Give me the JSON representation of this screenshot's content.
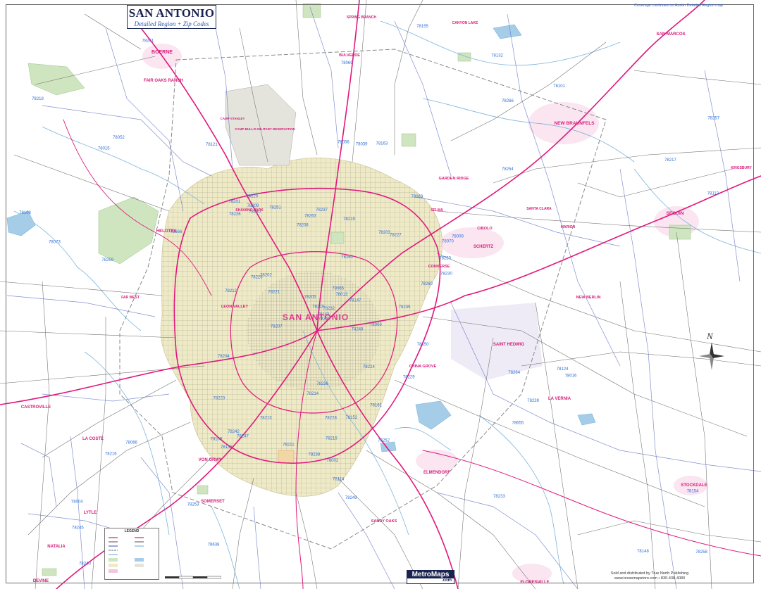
{
  "title": {
    "main": "SAN ANTONIO",
    "sub": "Detailed Region + Zip Codes"
  },
  "coverage_note": "Coverage continues on Austin Detailed Region map",
  "sold_by": [
    "Sold and distributed by True North Publishing",
    "www.texasmapstore.com • 830-438-4080"
  ],
  "brand": {
    "name": "MetroMaps",
    "suffix": ".com"
  },
  "compass": {
    "label": "N"
  },
  "legend": {
    "title": "LEGEND"
  },
  "colors": {
    "water": "#a6cde8",
    "water_line": "#7db4dc",
    "highway": "#e0197d",
    "road": "#6e6e6e",
    "urban": "#efeac6",
    "park": "#cfe5bf",
    "zip_boundary": "#5c6bc0",
    "city": "#f3c6dd"
  },
  "cities": [
    {
      "name": "San Antonio",
      "class": "major"
    },
    {
      "name": "Boerne"
    },
    {
      "name": "Fair Oaks Ranch"
    },
    {
      "name": "Camp Stanley"
    },
    {
      "name": "Camp Bullis Military Reservation"
    },
    {
      "name": "Spring Branch"
    },
    {
      "name": "Bulverde"
    },
    {
      "name": "Canyon Lake"
    },
    {
      "name": "San Marcos"
    },
    {
      "name": "New Braunfels"
    },
    {
      "name": "Garden Ridge"
    },
    {
      "name": "Kingsbury"
    },
    {
      "name": "Seguin"
    },
    {
      "name": "Santa Clara"
    },
    {
      "name": "Marion"
    },
    {
      "name": "Cibolo"
    },
    {
      "name": "Schertz"
    },
    {
      "name": "Selma"
    },
    {
      "name": "Converse"
    },
    {
      "name": "Helotes"
    },
    {
      "name": "Leon Valley"
    },
    {
      "name": "Far West"
    },
    {
      "name": "Castroville"
    },
    {
      "name": "La Coste"
    },
    {
      "name": "Von Ormy"
    },
    {
      "name": "Somerset"
    },
    {
      "name": "Lytle"
    },
    {
      "name": "Natalia"
    },
    {
      "name": "Devine"
    },
    {
      "name": "Sandy Oaks"
    },
    {
      "name": "Elmendorf"
    },
    {
      "name": "Floresville"
    },
    {
      "name": "Stockdale"
    },
    {
      "name": "La Vernia"
    },
    {
      "name": "Saint Hedwig"
    },
    {
      "name": "China Grove"
    },
    {
      "name": "New Berlin"
    },
    {
      "name": "Shavano Park"
    }
  ],
  "zips": [
    "78006",
    "78015",
    "78013",
    "78004",
    "78070",
    "78133",
    "78132",
    "78163",
    "78266",
    "78260",
    "78261",
    "78258",
    "78259",
    "78257",
    "78255",
    "78254",
    "78023",
    "78056",
    "78063",
    "78066",
    "78251",
    "78245",
    "78253",
    "78039",
    "78009",
    "78016",
    "78052",
    "78069",
    "78073",
    "78264",
    "78112",
    "78065",
    "78114",
    "78160",
    "78121",
    "78101",
    "78109",
    "78148",
    "78154",
    "78124",
    "78155",
    "78130",
    "78666",
    "78655",
    "78638",
    "78108",
    "78250",
    "78240",
    "78249",
    "78230",
    "78216",
    "78217",
    "78218",
    "78239",
    "78233",
    "78213",
    "78209",
    "78201",
    "78228",
    "78227",
    "78237",
    "78207",
    "78212",
    "78202",
    "78203",
    "78220",
    "78219",
    "78208",
    "78210",
    "78223",
    "78214",
    "78211",
    "78224",
    "78221",
    "78242",
    "78226",
    "78225",
    "78204",
    "78205",
    "78215",
    "78232",
    "78247",
    "78248",
    "78229",
    "78238",
    "78235",
    "78236",
    "78252",
    "78002",
    "78152",
    "78263",
    "78150",
    "78147",
    "78161",
    "78143"
  ]
}
